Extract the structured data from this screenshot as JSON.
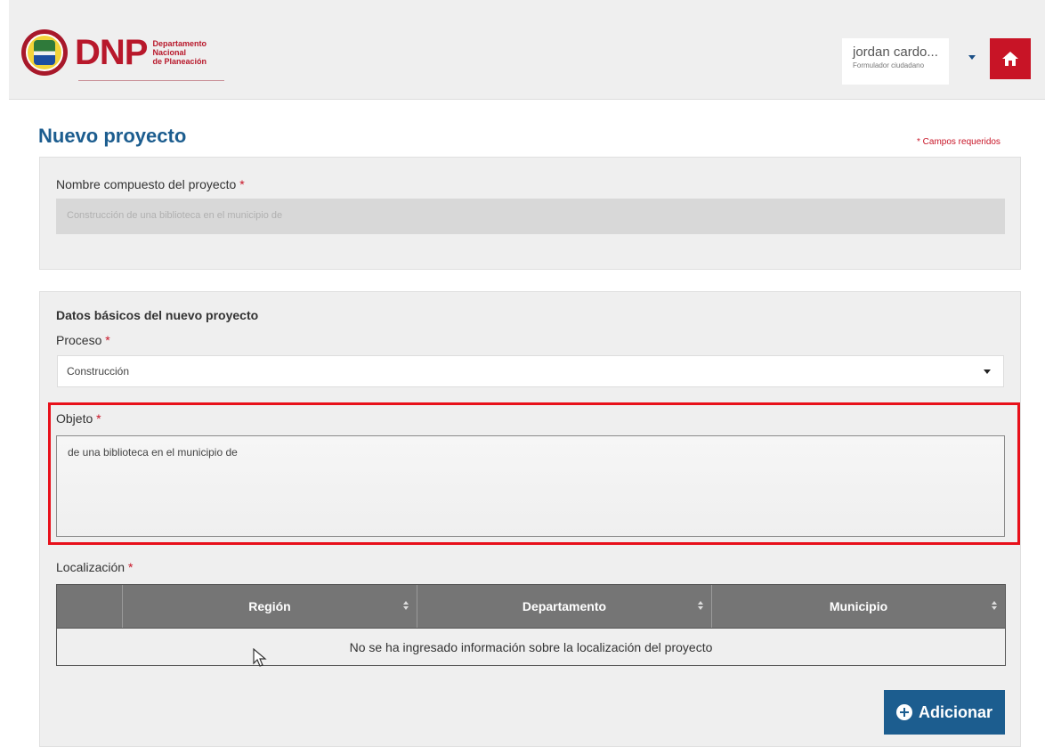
{
  "header": {
    "logo_text": "DNP",
    "logo_sub": [
      "Departamento",
      "Nacional",
      "de Planeación"
    ],
    "user_name": "jordan cardo...",
    "user_role": "Formulador ciudadano",
    "brand_color": "#c81426",
    "icons": {
      "home": "home-icon",
      "user_menu": "chevron-down-icon"
    }
  },
  "page": {
    "title": "Nuevo proyecto",
    "required_note": "* Campos requeridos"
  },
  "compound_name": {
    "label": "Nombre compuesto del proyecto",
    "required_mark": "*",
    "value": "Construcción de una biblioteca en el municipio de"
  },
  "basic_data": {
    "section_title": "Datos básicos del nuevo proyecto",
    "process_label": "Proceso",
    "process_required_mark": "*",
    "process_value": "Construcción",
    "object_label": "Objeto",
    "object_required_mark": "*",
    "object_value": "de una biblioteca en el municipio de",
    "highlight_color": "#e8101a"
  },
  "location": {
    "label": "Localización",
    "required_mark": "*",
    "columns": [
      "Región",
      "Departamento",
      "Municipio"
    ],
    "empty_message": "No se ha ingresado información sobre la localización del proyecto"
  },
  "actions": {
    "add_label": "Adicionar",
    "accent_color": "#1c5d8f"
  }
}
